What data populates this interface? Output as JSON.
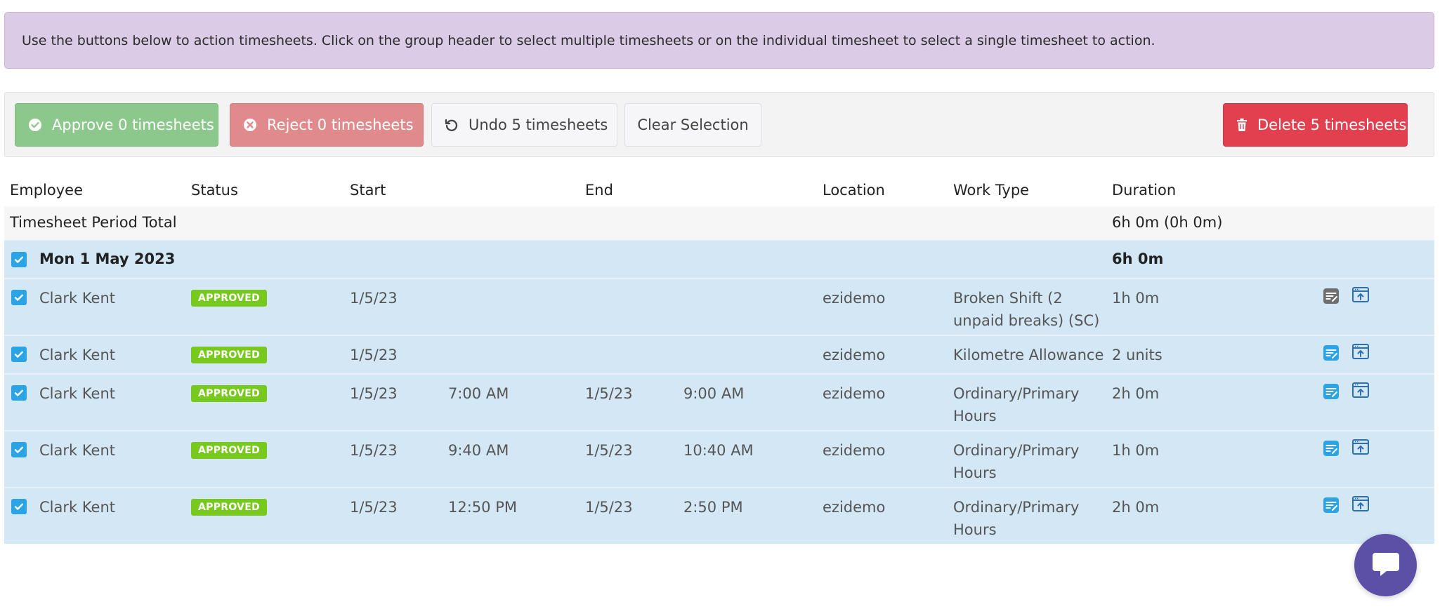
{
  "banner": {
    "text": "Use the buttons below to action timesheets. Click on the group header to select multiple timesheets or on the individual timesheet to select a single timesheet to action."
  },
  "toolbar": {
    "approve_label": "Approve 0 timesheets",
    "reject_label": "Reject 0 timesheets",
    "undo_label": "Undo 5 timesheets",
    "clear_label": "Clear Selection",
    "delete_label": "Delete 5 timesheets"
  },
  "table": {
    "headers": {
      "employee": "Employee",
      "status": "Status",
      "start": "Start",
      "end": "End",
      "location": "Location",
      "work_type": "Work Type",
      "duration": "Duration"
    },
    "total": {
      "label": "Timesheet Period Total",
      "duration": "6h 0m (0h 0m)"
    },
    "group": {
      "date": "Mon 1 May 2023",
      "duration": "6h 0m"
    },
    "rows": [
      {
        "employee": "Clark Kent",
        "status": "APPROVED",
        "start_date": "1/5/23",
        "start_time": "",
        "end_date": "",
        "end_time": "",
        "location": "ezidemo",
        "work_type": "Broken Shift (2 unpaid breaks) (SC)",
        "duration": "1h 0m",
        "note_icon": "note-icon-grey"
      },
      {
        "employee": "Clark Kent",
        "status": "APPROVED",
        "start_date": "1/5/23",
        "start_time": "",
        "end_date": "",
        "end_time": "",
        "location": "ezidemo",
        "work_type": "Kilometre Allowance",
        "duration": "2 units",
        "note_icon": "note-icon-blue"
      },
      {
        "employee": "Clark Kent",
        "status": "APPROVED",
        "start_date": "1/5/23",
        "start_time": "7:00 AM",
        "end_date": "1/5/23",
        "end_time": "9:00 AM",
        "location": "ezidemo",
        "work_type": "Ordinary/Primary Hours",
        "duration": "2h 0m",
        "note_icon": "note-icon-blue"
      },
      {
        "employee": "Clark Kent",
        "status": "APPROVED",
        "start_date": "1/5/23",
        "start_time": "9:40 AM",
        "end_date": "1/5/23",
        "end_time": "10:40 AM",
        "location": "ezidemo",
        "work_type": "Ordinary/Primary Hours",
        "duration": "1h 0m",
        "note_icon": "note-icon-blue"
      },
      {
        "employee": "Clark Kent",
        "status": "APPROVED",
        "start_date": "1/5/23",
        "start_time": "12:50 PM",
        "end_date": "1/5/23",
        "end_time": "2:50 PM",
        "location": "ezidemo",
        "work_type": "Ordinary/Primary Hours",
        "duration": "2h 0m",
        "note_icon": "note-icon-blue"
      }
    ]
  },
  "colors": {
    "banner_bg": "#dccbe6",
    "approve": "#8cc88c",
    "reject": "#e08a8c",
    "delete": "#e2404f",
    "row_bg": "#d3e7f5",
    "badge": "#78c91e",
    "checkbox": "#2aa4e4",
    "chat": "#5c4fa6"
  }
}
